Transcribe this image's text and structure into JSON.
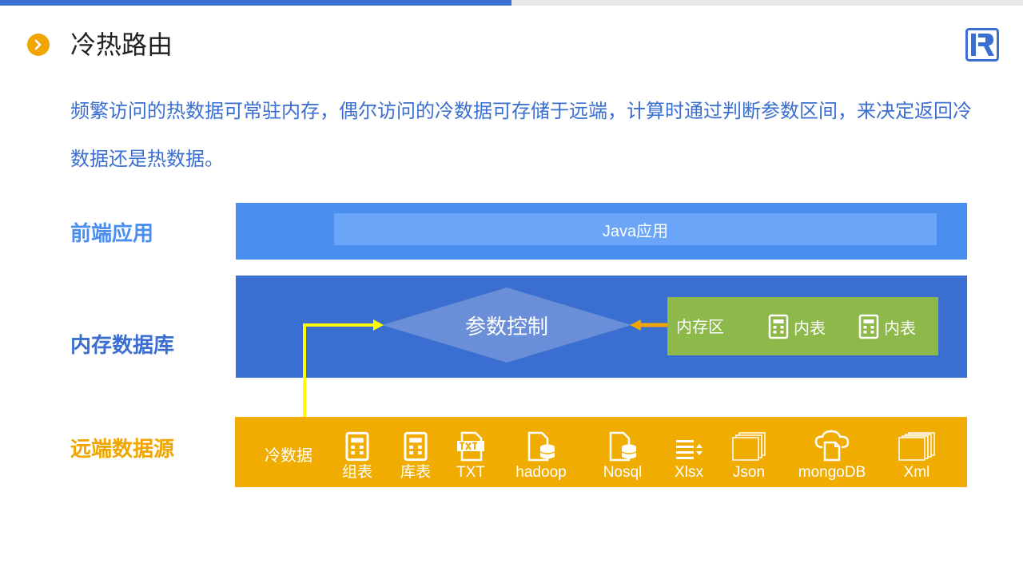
{
  "header": {
    "title": "冷热路由"
  },
  "description": "频繁访问的热数据可常驻内存，偶尔访问的冷数据可存储于远端，计算时通过判断参数区间，来决定返回冷数据还是热数据。",
  "layers": {
    "front": {
      "label": "前端应用",
      "app": "Java应用"
    },
    "memory": {
      "label": "内存数据库",
      "control": "参数控制",
      "zone_label": "内存区",
      "tables": [
        "内表",
        "内表"
      ]
    },
    "remote": {
      "label": "远端数据源",
      "cold_label": "冷数据",
      "sources": [
        {
          "label": "组表",
          "icon": "table-file-icon"
        },
        {
          "label": "库表",
          "icon": "table-file-icon"
        },
        {
          "label": "TXT",
          "icon": "txt-file-icon"
        },
        {
          "label": "hadoop",
          "icon": "database-file-icon"
        },
        {
          "label": "Nosql",
          "icon": "database-file-icon"
        },
        {
          "label": "Xlsx",
          "icon": "list-sort-icon"
        },
        {
          "label": "Json",
          "icon": "stacked-pages-icon"
        },
        {
          "label": "mongoDB",
          "icon": "cloud-file-icon"
        },
        {
          "label": "Xml",
          "icon": "stacked-pages-icon"
        }
      ]
    }
  },
  "colors": {
    "front": "#4a8ff0",
    "memory": "#3a6ed0",
    "remote": "#f0ac00",
    "memory_zone": "#8db84a",
    "accent": "#f0a500",
    "yellow_arrow": "#ffff00"
  }
}
